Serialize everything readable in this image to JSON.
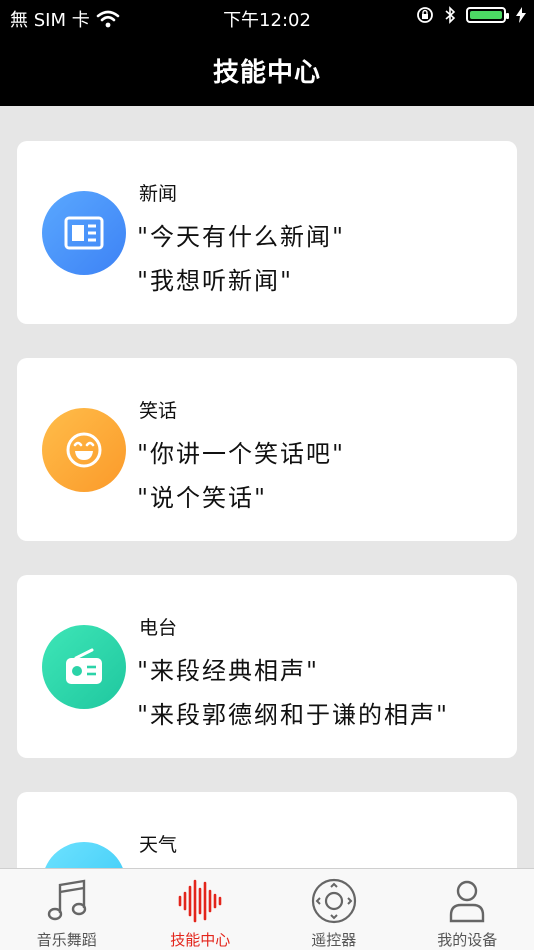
{
  "status_bar": {
    "carrier": "無 SIM 卡",
    "time": "下午12:02",
    "battery_level": 1.0
  },
  "header": {
    "title": "技能中心"
  },
  "skills": [
    {
      "title": "新闻",
      "examples": [
        "\"今天有什么新闻\"",
        "\"我想听新闻\""
      ],
      "icon": "newspaper-icon",
      "color_from": "#5aa8ff",
      "color_to": "#3d82f5"
    },
    {
      "title": "笑话",
      "examples": [
        "\"你讲一个笑话吧\"",
        "\"说个笑话\""
      ],
      "icon": "laughing-face-icon",
      "color_from": "#ffbd4a",
      "color_to": "#fb9a2a"
    },
    {
      "title": "电台",
      "examples": [
        "\"来段经典相声\"",
        "\"来段郭德纲和于谦的相声\""
      ],
      "icon": "radio-icon",
      "color_from": "#3ee6b7",
      "color_to": "#1fc79f"
    },
    {
      "title": "天气",
      "examples": [],
      "icon": "weather-icon",
      "color_from": "#6ee2ff",
      "color_to": "#38c8f5"
    }
  ],
  "tab_bar": {
    "active_color": "#e3251b",
    "items": [
      {
        "label": "音乐舞蹈",
        "icon": "music-note-icon",
        "active": false
      },
      {
        "label": "技能中心",
        "icon": "sound-wave-icon",
        "active": true
      },
      {
        "label": "遥控器",
        "icon": "remote-control-icon",
        "active": false
      },
      {
        "label": "我的设备",
        "icon": "user-icon",
        "active": false
      }
    ]
  }
}
